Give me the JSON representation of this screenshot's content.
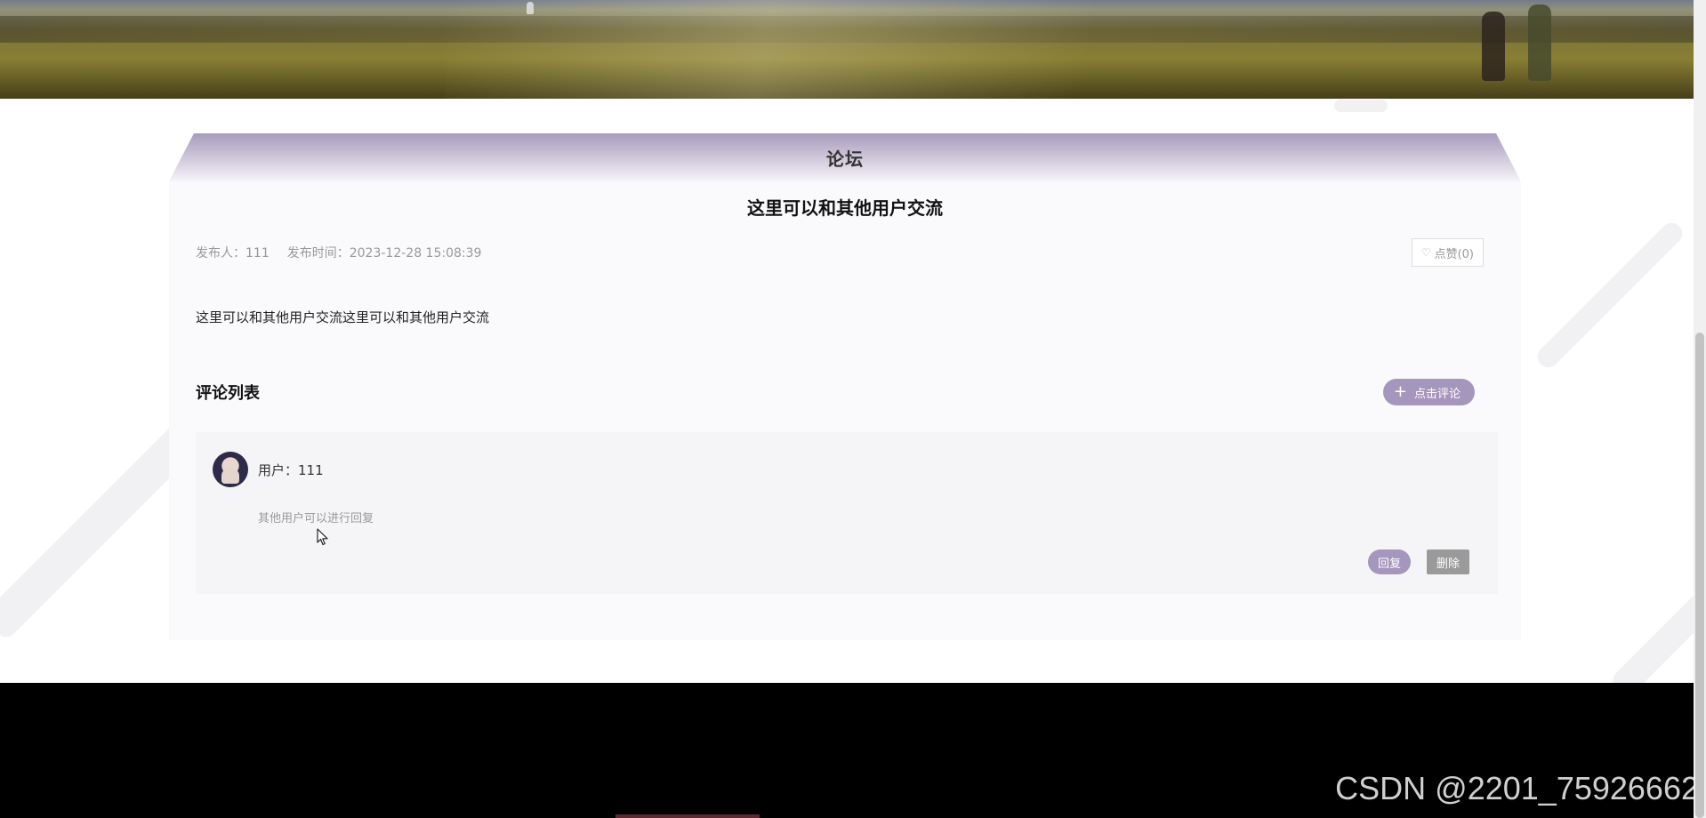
{
  "forum": {
    "section_title": "论坛"
  },
  "post": {
    "title": "这里可以和其他用户交流",
    "publisher": "发布人：111",
    "publish_time": "发布时间：2023-12-28 15:08:39",
    "like_label": "点赞(0)",
    "body": "这里可以和其他用户交流这里可以和其他用户交流"
  },
  "comments": {
    "heading": "评论列表",
    "add_label": "点击评论",
    "items": [
      {
        "user": "用户：111",
        "text": "其他用户可以进行回复",
        "reply_label": "回复",
        "delete_label": "删除"
      }
    ]
  },
  "watermark": "CSDN @2201_75926662",
  "icons": {
    "like": "heart-icon",
    "add": "plus-icon",
    "cursor": "cursor-icon"
  },
  "colors": {
    "accent": "#a596bd",
    "delete": "#9a9a9a",
    "footer": "#000000"
  }
}
